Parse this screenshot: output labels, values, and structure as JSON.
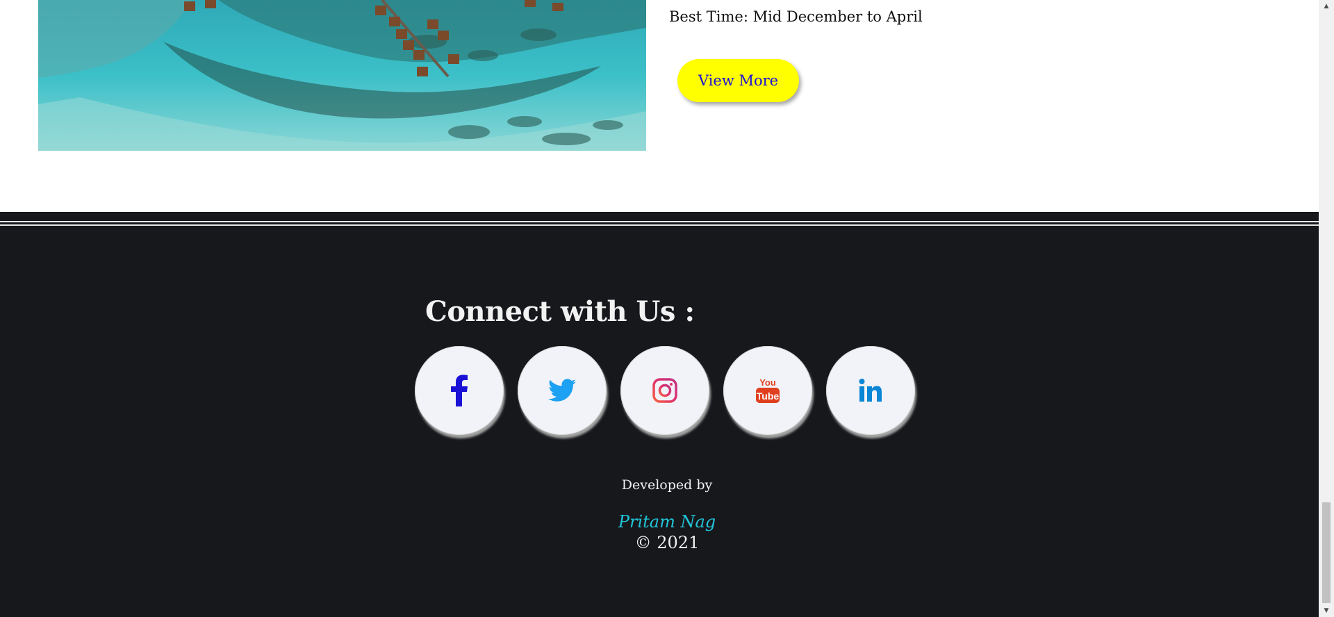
{
  "destination": {
    "best_time": "Best Time: Mid December to April",
    "view_more_label": "View More"
  },
  "footer": {
    "connect_title": "Connect with Us :",
    "socials": [
      {
        "name": "facebook",
        "icon": "facebook-icon",
        "color": "#1a10d6"
      },
      {
        "name": "twitter",
        "icon": "twitter-icon",
        "color": "#1da1f2"
      },
      {
        "name": "instagram",
        "icon": "instagram-icon",
        "color": "#e1306c"
      },
      {
        "name": "youtube",
        "icon": "youtube-icon",
        "color": "#e0401f"
      },
      {
        "name": "linkedin",
        "icon": "linkedin-icon",
        "color": "#0a86d6"
      }
    ],
    "developed_by": "Developed by",
    "author": "Pritam Nag",
    "copyright": "© 2021"
  },
  "colors": {
    "footer_bg": "#17181c",
    "button_bg": "#ffff00",
    "button_text": "#1a10d6",
    "author_text": "#22c4d8"
  }
}
